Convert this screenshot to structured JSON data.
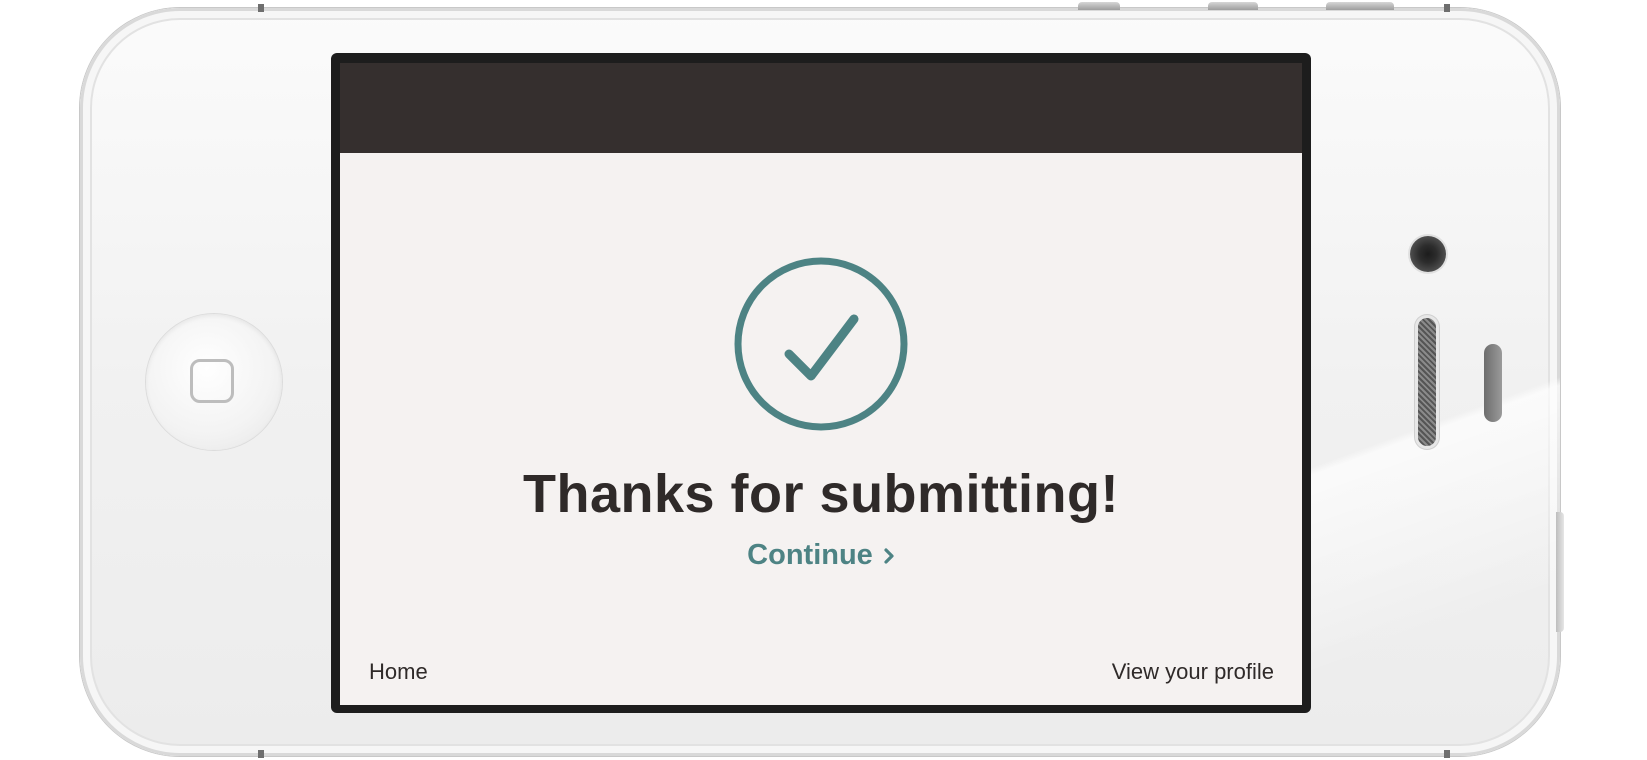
{
  "screen": {
    "title": "Thanks for submitting!",
    "continue_label": "Continue",
    "continue_icon": "chevron-right-icon",
    "status_icon": "checkmark-circle-icon",
    "accent_color": "#4d8384",
    "header_color": "#352f2e",
    "background_color": "#f5f2f1"
  },
  "footer": {
    "home_label": "Home",
    "profile_label": "View your profile"
  },
  "device": {
    "home_button_icon": "home-button-icon"
  }
}
